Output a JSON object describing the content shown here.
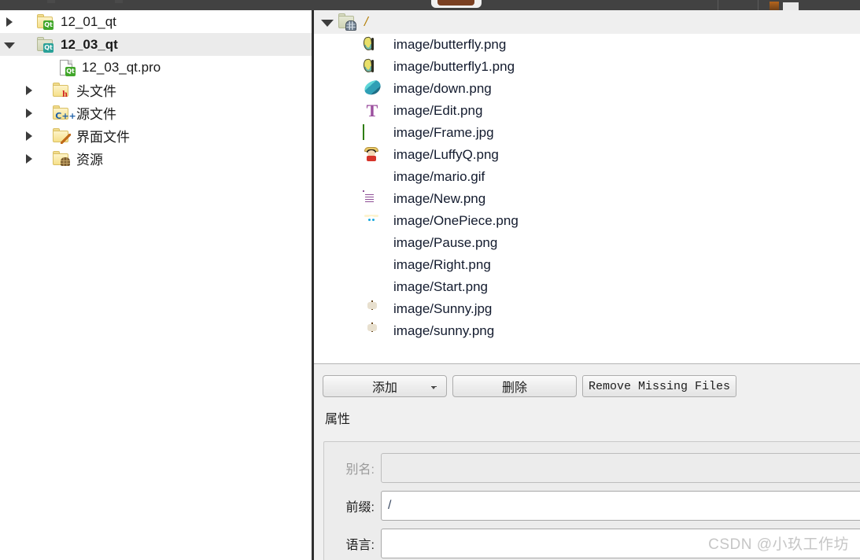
{
  "toolbar": {
    "tab_hint": "toolbar-cropped",
    "colors": {
      "bar": "#424242",
      "tab_accent": "#7a4022"
    }
  },
  "project_tree": {
    "items": [
      {
        "label": "12_01_qt",
        "icon": "folder-qt-icon",
        "arrow": "right",
        "indent": 0,
        "selected": false,
        "bold": false
      },
      {
        "label": "12_03_qt",
        "icon": "folder-qt-open-icon",
        "arrow": "down",
        "indent": 0,
        "selected": true,
        "bold": true
      },
      {
        "label": "12_03_qt.pro",
        "icon": "file-pro-icon",
        "arrow": "none",
        "indent": 1,
        "selected": false,
        "bold": false
      },
      {
        "label": "头文件",
        "icon": "folder-headers-icon",
        "arrow": "right",
        "indent": 1,
        "selected": false,
        "bold": false
      },
      {
        "label": "源文件",
        "icon": "folder-sources-icon",
        "arrow": "right",
        "indent": 1,
        "selected": false,
        "bold": false
      },
      {
        "label": "界面文件",
        "icon": "folder-forms-icon",
        "arrow": "right",
        "indent": 1,
        "selected": false,
        "bold": false
      },
      {
        "label": "资源",
        "icon": "folder-resources-icon",
        "arrow": "right",
        "indent": 1,
        "selected": false,
        "bold": false
      }
    ]
  },
  "resource_editor": {
    "root": {
      "label": "/",
      "icon": "resource-prefix-icon",
      "arrow": "down",
      "color": "#b5820d"
    },
    "files": [
      {
        "path": "image/butterfly.png",
        "icon": "butterfly-thumb"
      },
      {
        "path": "image/butterfly1.png",
        "icon": "butterfly-thumb"
      },
      {
        "path": "image/down.png",
        "icon": "teal-butterfly-thumb"
      },
      {
        "path": "image/Edit.png",
        "icon": "letter-t-thumb"
      },
      {
        "path": "image/Frame.jpg",
        "icon": "green-frame-thumb"
      },
      {
        "path": "image/LuffyQ.png",
        "icon": "luffy-thumb"
      },
      {
        "path": "image/mario.gif",
        "icon": "mario-thumb"
      },
      {
        "path": "image/New.png",
        "icon": "new-document-thumb"
      },
      {
        "path": "image/OnePiece.png",
        "icon": "onepiece-skull-thumb"
      },
      {
        "path": "image/Pause.png",
        "icon": "pause-button-thumb"
      },
      {
        "path": "image/Right.png",
        "icon": "fast-forward-button-thumb"
      },
      {
        "path": "image/Start.png",
        "icon": "record-button-thumb"
      },
      {
        "path": "image/Sunny.jpg",
        "icon": "sunny-ship-thumb"
      },
      {
        "path": "image/sunny.png",
        "icon": "sunny-ship-thumb"
      }
    ],
    "buttons": {
      "add": "添加",
      "remove": "删除",
      "remove_missing": "Remove Missing Files"
    },
    "properties": {
      "title": "属性",
      "fields": [
        {
          "label": "别名:",
          "value": "",
          "disabled": true,
          "name": "alias-field"
        },
        {
          "label": "前缀:",
          "value": "/",
          "disabled": false,
          "name": "prefix-field"
        },
        {
          "label": "语言:",
          "value": "",
          "disabled": false,
          "name": "language-field"
        }
      ]
    }
  },
  "watermark": {
    "text": "CSDN @小玖工作坊",
    "color": "#c6c6c6"
  }
}
